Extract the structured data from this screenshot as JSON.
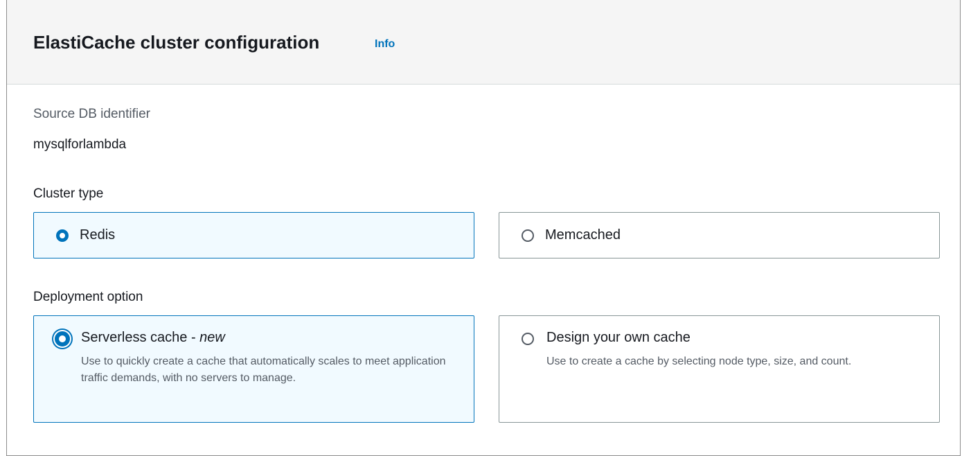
{
  "header": {
    "title": "ElastiCache cluster configuration",
    "info_label": "Info"
  },
  "source_db": {
    "label": "Source DB identifier",
    "value": "mysqlforlambda"
  },
  "cluster_type": {
    "label": "Cluster type",
    "options": [
      {
        "label": "Redis",
        "selected": true
      },
      {
        "label": "Memcached",
        "selected": false
      }
    ]
  },
  "deployment_option": {
    "label": "Deployment option",
    "options": [
      {
        "label": "Serverless cache - ",
        "label_emphasis": "new",
        "description": "Use to quickly create a cache that automatically scales to meet application traffic demands, with no servers to manage.",
        "selected": true
      },
      {
        "label": "Design your own cache",
        "description": "Use to create a cache by selecting node type, size, and count.",
        "selected": false
      }
    ]
  },
  "colors": {
    "accent": "#0073bb",
    "selected_background": "#f1faff",
    "header_background": "#f5f5f5"
  }
}
